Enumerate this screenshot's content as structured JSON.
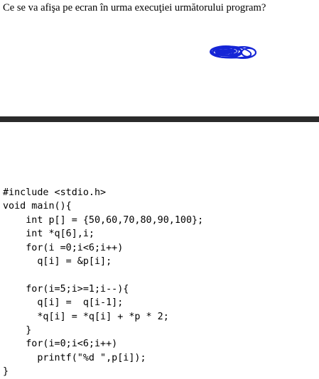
{
  "question": "Ce se va afişa pe ecran în urma execuţiei următorului program?",
  "colors": {
    "text": "#000000",
    "scribble": "#1525d6",
    "divider": "#2b2b2b"
  },
  "code": {
    "lines": [
      "#include <stdio.h>",
      "void main(){",
      "    int p[] = {50,60,70,80,90,100};",
      "    int *q[6],i;",
      "    for(i =0;i<6;i++)",
      "      q[i] = &p[i];",
      "",
      "    for(i=5;i>=1;i--){",
      "      q[i] =  q[i-1];",
      "      *q[i] = *q[i] + *p * 2;",
      "    }",
      "    for(i=0;i<6;i++)",
      "      printf(\"%d \",p[i]);",
      "}"
    ]
  }
}
